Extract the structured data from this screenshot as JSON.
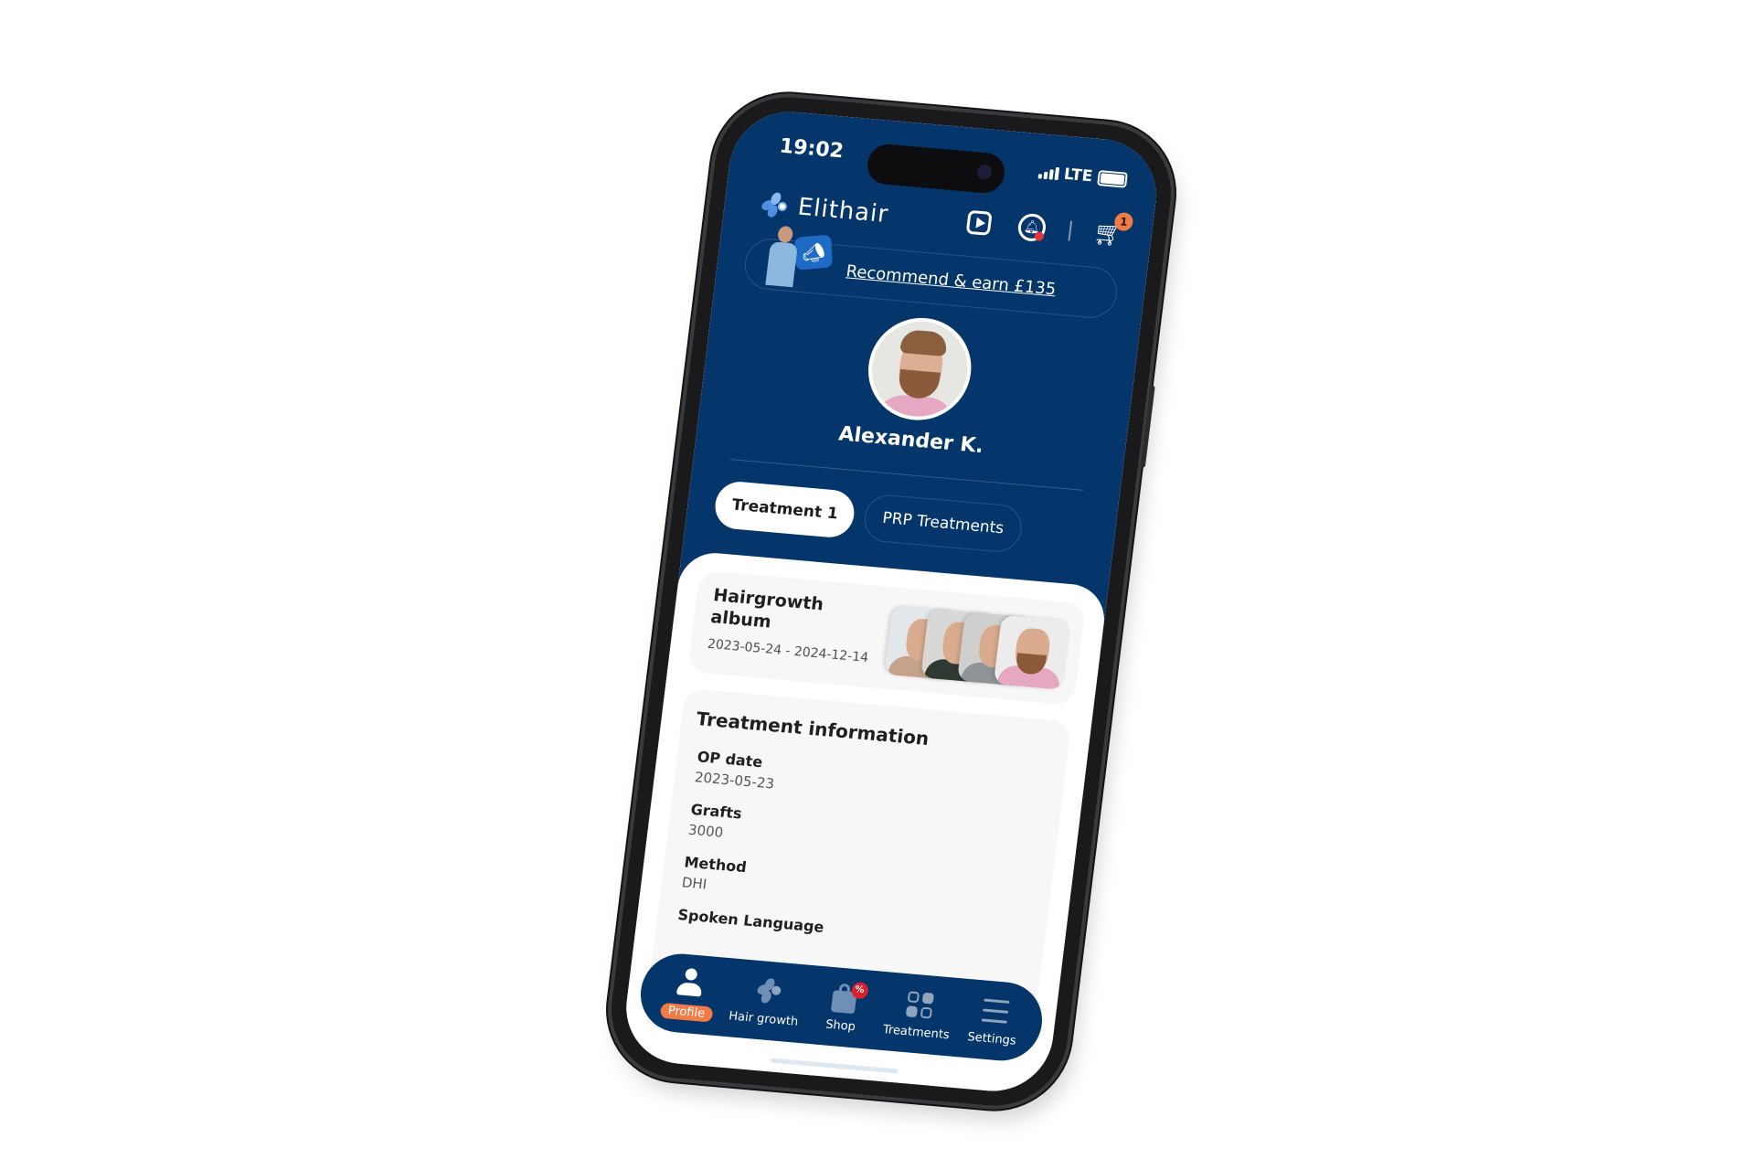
{
  "status_bar": {
    "time": "19:02",
    "network": "LTE"
  },
  "header": {
    "app_name": "Elithair",
    "icons": [
      "video-info-icon",
      "bell-icon",
      "cart-icon"
    ],
    "cart_count": "1",
    "notification_dot": true
  },
  "promo": {
    "text": "Recommend & earn £135"
  },
  "profile": {
    "name": "Alexander K."
  },
  "tabs": [
    {
      "label": "Treatment 1",
      "active": true
    },
    {
      "label": "PRP Treatments",
      "active": false
    }
  ],
  "album": {
    "title": "Hairgrowth album",
    "dates": "2023-05-24 - 2024-12-14"
  },
  "treatment_info": {
    "title": "Treatment information",
    "fields": [
      {
        "label": "OP date",
        "value": "2023-05-23"
      },
      {
        "label": "Grafts",
        "value": "3000"
      },
      {
        "label": "Method",
        "value": "DHI"
      },
      {
        "label": "Spoken Language",
        "value": ""
      }
    ]
  },
  "nav": {
    "items": [
      {
        "label": "Profile",
        "icon": "person-icon",
        "active": true
      },
      {
        "label": "Hair growth",
        "icon": "elithair-logo-icon",
        "active": false
      },
      {
        "label": "Shop",
        "icon": "shop-bag-icon",
        "badge": "%",
        "active": false
      },
      {
        "label": "Treatments",
        "icon": "grid-icon",
        "active": false
      },
      {
        "label": "Settings",
        "icon": "menu-icon",
        "active": false
      }
    ]
  },
  "colors": {
    "primary": "#04356b",
    "accent": "#f27a45",
    "alert": "#e8333f",
    "card": "#f7f7f7"
  }
}
